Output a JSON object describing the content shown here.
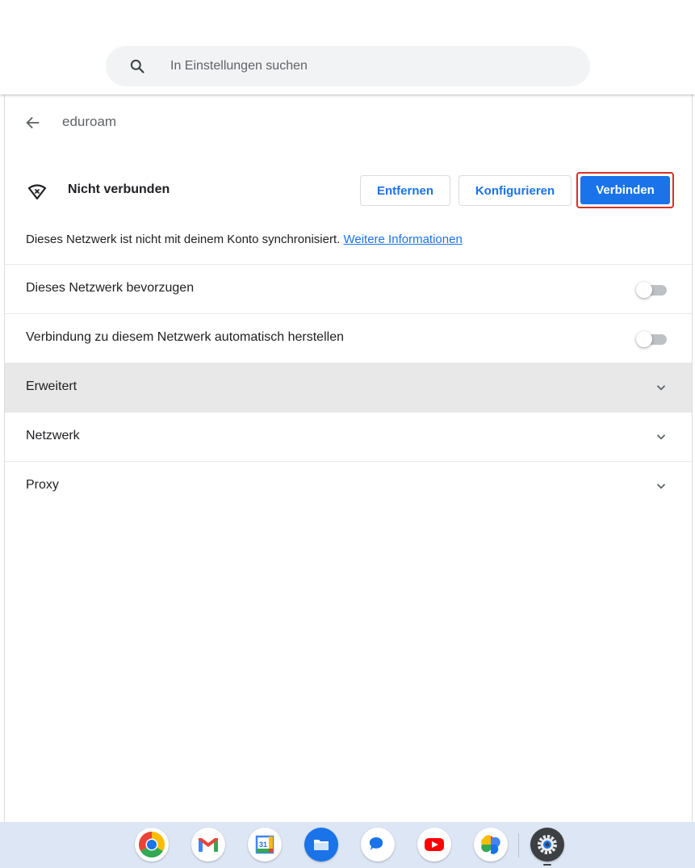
{
  "search": {
    "placeholder": "In Einstellungen suchen"
  },
  "header": {
    "title": "eduroam"
  },
  "network": {
    "status": "Nicht verbunden",
    "buttons": {
      "remove": "Entfernen",
      "configure": "Konfigurieren",
      "connect": "Verbinden"
    },
    "sync_text": "Dieses Netzwerk ist nicht mit deinem Konto synchronisiert.",
    "sync_link": "Weitere Informationen"
  },
  "settings": {
    "prefer": {
      "label": "Dieses Netzwerk bevorzugen",
      "enabled": false
    },
    "autoconnect": {
      "label": "Verbindung zu diesem Netzwerk automatisch herstellen",
      "enabled": false
    }
  },
  "sections": {
    "advanced": "Erweitert",
    "network": "Netzwerk",
    "proxy": "Proxy"
  },
  "shelf": {
    "apps": [
      "chrome-icon",
      "gmail-icon",
      "calendar-icon",
      "files-icon",
      "messages-icon",
      "youtube-icon",
      "photos-icon",
      "settings-icon"
    ],
    "calendar_day": "31"
  },
  "colors": {
    "accent": "#1a73e8",
    "highlight_border": "#d93025",
    "shelf": "#dde6f4"
  }
}
